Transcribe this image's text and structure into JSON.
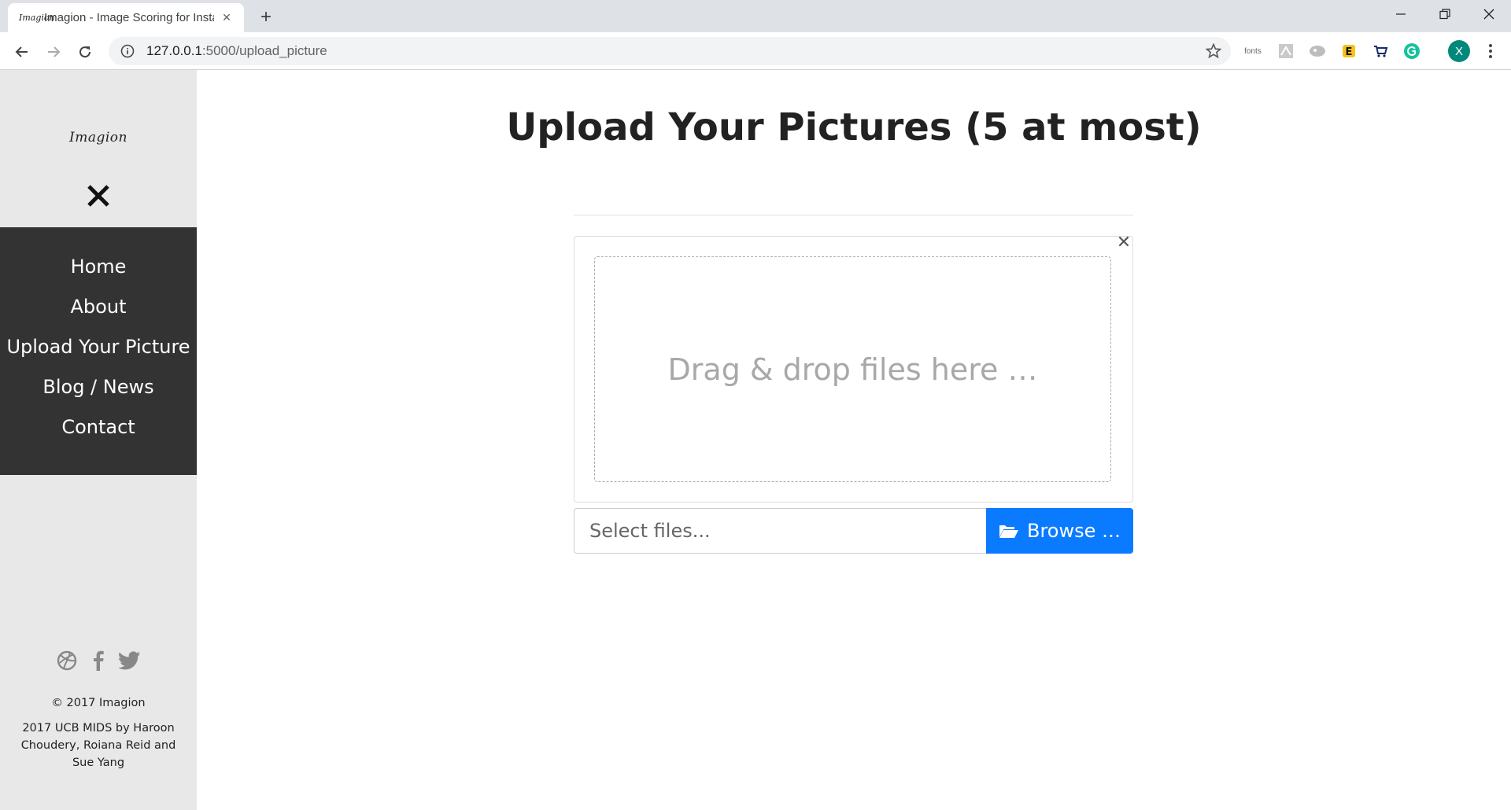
{
  "browser": {
    "tab_title": "Imagion - Image Scoring for Insta",
    "favicon_text": "Imagion",
    "url_host": "127.0.0.1",
    "url_path": ":5000/upload_picture",
    "extension_fonts_label": "fonts",
    "profile_initial": "X"
  },
  "sidebar": {
    "brand": "Imagion",
    "menu": [
      {
        "label": "Home"
      },
      {
        "label": "About"
      },
      {
        "label": "Upload Your Picture"
      },
      {
        "label": "Blog / News"
      },
      {
        "label": "Contact"
      }
    ],
    "social": [
      "dribbble-icon",
      "facebook-icon",
      "twitter-icon"
    ],
    "copyright": "© 2017 Imagion",
    "credits": "2017 UCB MIDS by Haroon Choudery, Roiana Reid and Sue Yang"
  },
  "main": {
    "title": "Upload Your Pictures (5 at most)",
    "dropzone_text": "Drag & drop files here …",
    "file_placeholder": "Select files...",
    "browse_label": "Browse …"
  },
  "colors": {
    "menu_bg": "#333333",
    "sidebar_bg": "#e8e8e8",
    "browse_bg": "#0a7bff"
  }
}
